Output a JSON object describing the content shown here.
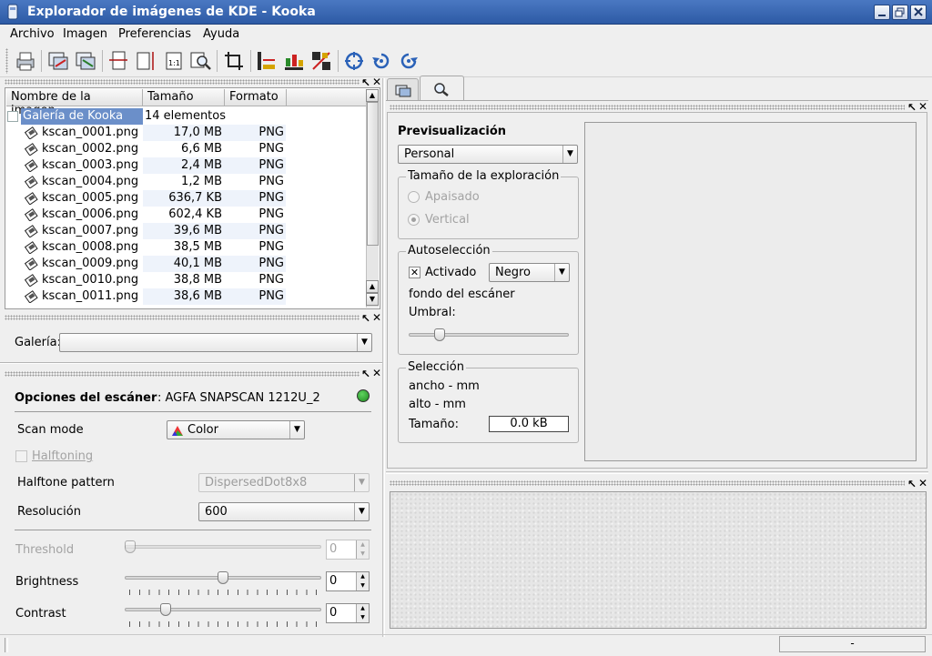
{
  "window": {
    "title": "Explorador de imágenes de KDE - Kooka"
  },
  "menubar": [
    "Archivo",
    "Imagen",
    "Preferencias",
    "Ayuda"
  ],
  "toolbar": {
    "icons": [
      "print-icon",
      "scan-to-gallery-icon",
      "save-scan-icon",
      "fit-width-icon",
      "fit-height-icon",
      "original-size-icon",
      "zoom-icon",
      "crop-icon",
      "mirror-horizontal-icon",
      "mirror-vertical-icon",
      "mirror-both-icon",
      "rotate-icon",
      "rotate-left-icon",
      "rotate-right-icon"
    ]
  },
  "gallery_table": {
    "columns": [
      "Nombre de la imagen",
      "Tamaño",
      "Formato"
    ],
    "root": {
      "name": "Galería de Kooka",
      "count": "14 elementos"
    },
    "rows": [
      {
        "name": "kscan_0001.png",
        "size": "17,0 MB",
        "format": "PNG"
      },
      {
        "name": "kscan_0002.png",
        "size": "6,6 MB",
        "format": "PNG"
      },
      {
        "name": "kscan_0003.png",
        "size": "2,4 MB",
        "format": "PNG"
      },
      {
        "name": "kscan_0004.png",
        "size": "1,2 MB",
        "format": "PNG"
      },
      {
        "name": "kscan_0005.png",
        "size": "636,7 KB",
        "format": "PNG"
      },
      {
        "name": "kscan_0006.png",
        "size": "602,4 KB",
        "format": "PNG"
      },
      {
        "name": "kscan_0007.png",
        "size": "39,6 MB",
        "format": "PNG"
      },
      {
        "name": "kscan_0008.png",
        "size": "38,5 MB",
        "format": "PNG"
      },
      {
        "name": "kscan_0009.png",
        "size": "40,1 MB",
        "format": "PNG"
      },
      {
        "name": "kscan_0010.png",
        "size": "38,8 MB",
        "format": "PNG"
      },
      {
        "name": "kscan_0011.png",
        "size": "38,6 MB",
        "format": "PNG"
      }
    ]
  },
  "gallery_selector": {
    "label": "Galería:",
    "value": ""
  },
  "scanner_options": {
    "title": "Opciones del escáner",
    "device": ": AGFA SNAPSCAN 1212U_2",
    "scan_mode_label": "Scan mode",
    "scan_mode_value": "Color",
    "halftoning_label": "Halftoning",
    "halftone_pattern_label": "Halftone pattern",
    "halftone_pattern_value": "DispersedDot8x8",
    "resolution_label": "Resolución",
    "resolution_value": "600",
    "threshold_label": "Threshold",
    "threshold_value": "0",
    "brightness_label": "Brightness",
    "brightness_value": "0",
    "contrast_label": "Contrast",
    "contrast_value": "0",
    "status_color": "#1f8a1f"
  },
  "preview": {
    "title": "Previsualización",
    "size_preset": "Personal",
    "scan_size_group": "Tamaño de la exploración",
    "landscape": "Apaisado",
    "portrait": "Vertical",
    "autoselect_group": "Autoselección",
    "enabled_label": "Activado",
    "background_value": "Negro",
    "scanner_background": "fondo del escáner",
    "threshold_label": "Umbral:",
    "selection_group": "Selección",
    "width_text": "ancho - mm",
    "height_text": "alto - mm",
    "size_label": "Tamaño:",
    "size_value": "0.0 kB"
  },
  "statusbar": {
    "right": "-"
  }
}
